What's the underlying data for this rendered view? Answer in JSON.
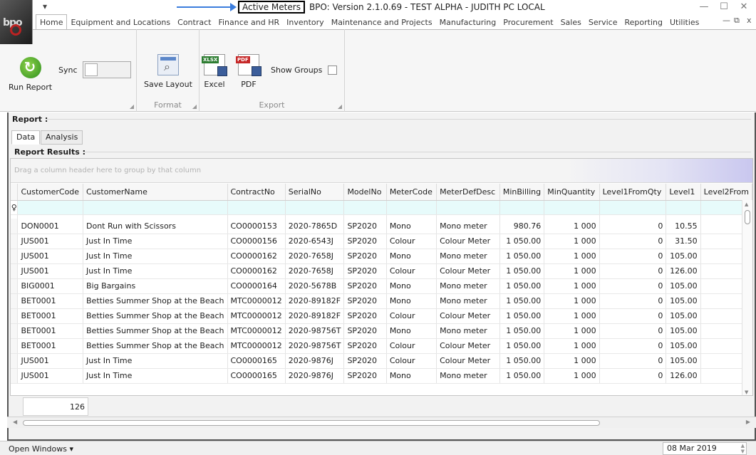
{
  "titlebar": {
    "qat_glyph": "▾",
    "screen_name": "Active Meters",
    "title_rest": "BPO: Version 2.1.0.69 - TEST ALPHA - JUDITH PC LOCAL",
    "logo_text": "bpo"
  },
  "window_controls": {
    "minimize": "—",
    "maximize": "☐",
    "close": "✕"
  },
  "mdi_controls": {
    "minimize": "—",
    "restore": "⧉",
    "close": "x"
  },
  "ribbon_tabs": [
    "Home",
    "Equipment and Locations",
    "Contract",
    "Finance and HR",
    "Inventory",
    "Maintenance and Projects",
    "Manufacturing",
    "Procurement",
    "Sales",
    "Service",
    "Reporting",
    "Utilities"
  ],
  "ribbon": {
    "run_report": "Run Report",
    "sync": "Sync",
    "save_layout": "Save Layout",
    "format_group": "Format",
    "excel": "Excel",
    "pdf": "PDF",
    "excel_tag": "XLSX",
    "pdf_tag": "PDF",
    "show_groups": "Show Groups",
    "export_group": "Export"
  },
  "report": {
    "label": "Report :",
    "tabs": [
      "Data",
      "Analysis"
    ],
    "results_label": "Report Results :",
    "group_hint": "Drag a column header here to group by that column",
    "filter_glyph": "♀"
  },
  "grid": {
    "columns": [
      "CustomerCode",
      "CustomerName",
      "ContractNo",
      "SerialNo",
      "ModelNo",
      "MeterCode",
      "MeterDefDesc",
      "MinBilling",
      "MinQuantity",
      "Level1FromQty",
      "Level1",
      "Level2From"
    ],
    "rows": [
      [
        "DON0001",
        "Dont Run with Scissors",
        "CO0000153",
        "2020-7865D",
        "SP2020",
        "Mono",
        "Mono meter",
        "980.76",
        "1 000",
        "0",
        "10.55",
        ""
      ],
      [
        "JUS001",
        "Just In Time",
        "CO0000156",
        "2020-6543J",
        "SP2020",
        "Colour",
        "Colour Meter",
        "1 050.00",
        "1 000",
        "0",
        "31.50",
        ""
      ],
      [
        "JUS001",
        "Just In Time",
        "CO0000162",
        "2020-7658J",
        "SP2020",
        "Mono",
        "Mono meter",
        "1 050.00",
        "1 000",
        "0",
        "105.00",
        ""
      ],
      [
        "JUS001",
        "Just In Time",
        "CO0000162",
        "2020-7658J",
        "SP2020",
        "Colour",
        "Colour Meter",
        "1 050.00",
        "1 000",
        "0",
        "126.00",
        ""
      ],
      [
        "BIG0001",
        "Big Bargains",
        "CO0000164",
        "2020-5678B",
        "SP2020",
        "Mono",
        "Mono meter",
        "1 050.00",
        "1 000",
        "0",
        "105.00",
        ""
      ],
      [
        "BET0001",
        "Betties Summer Shop at the Beach",
        "MTC0000012",
        "2020-89182F",
        "SP2020",
        "Mono",
        "Mono meter",
        "1 050.00",
        "1 000",
        "0",
        "105.00",
        ""
      ],
      [
        "BET0001",
        "Betties Summer Shop at the Beach",
        "MTC0000012",
        "2020-89182F",
        "SP2020",
        "Colour",
        "Colour Meter",
        "1 050.00",
        "1 000",
        "0",
        "105.00",
        ""
      ],
      [
        "BET0001",
        "Betties Summer Shop at the Beach",
        "MTC0000012",
        "2020-98756T",
        "SP2020",
        "Mono",
        "Mono meter",
        "1 050.00",
        "1 000",
        "0",
        "105.00",
        ""
      ],
      [
        "BET0001",
        "Betties Summer Shop at the Beach",
        "MTC0000012",
        "2020-98756T",
        "SP2020",
        "Colour",
        "Colour Meter",
        "1 050.00",
        "1 000",
        "0",
        "105.00",
        ""
      ],
      [
        "JUS001",
        "Just In Time",
        "CO0000165",
        "2020-9876J",
        "SP2020",
        "Colour",
        "Colour Meter",
        "1 050.00",
        "1 000",
        "0",
        "105.00",
        ""
      ],
      [
        "JUS001",
        "Just In Time",
        "CO0000165",
        "2020-9876J",
        "SP2020",
        "Mono",
        "Mono meter",
        "1 050.00",
        "1 000",
        "0",
        "126.00",
        ""
      ]
    ],
    "numeric_columns": [
      7,
      8,
      9,
      10
    ],
    "row_count": "126"
  },
  "statusbar": {
    "open_windows": "Open Windows ▾",
    "date": "08 Mar 2019"
  },
  "colors": {
    "accent_arrow": "#3b7ddd",
    "filter_row": "#e7fbfb"
  }
}
